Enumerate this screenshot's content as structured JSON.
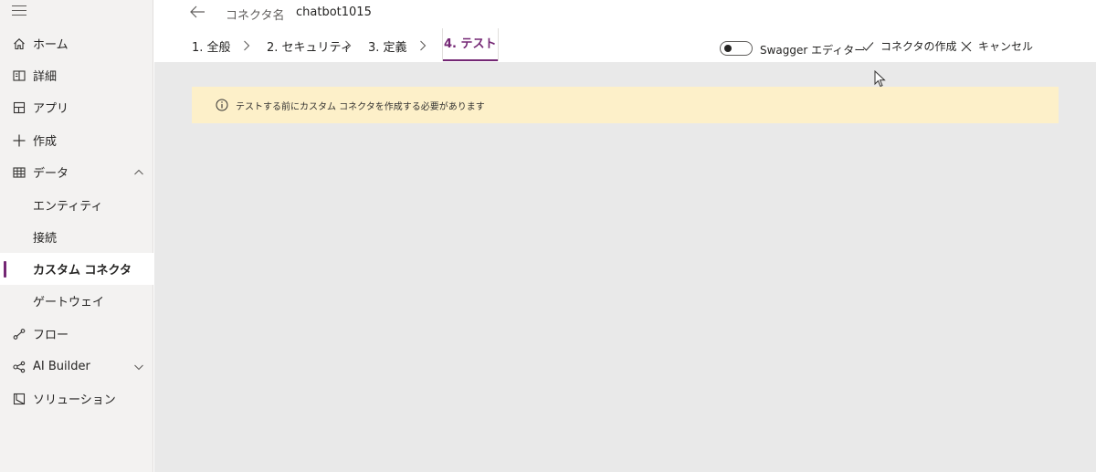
{
  "sidebar": {
    "items": [
      {
        "label": "ホーム",
        "icon": "home-icon"
      },
      {
        "label": "詳細",
        "icon": "book-icon"
      },
      {
        "label": "アプリ",
        "icon": "apps-icon"
      },
      {
        "label": "作成",
        "icon": "plus-icon"
      },
      {
        "label": "データ",
        "icon": "table-icon",
        "expanded": true
      },
      {
        "label": "エンティティ"
      },
      {
        "label": "接続"
      },
      {
        "label": "カスタム コネクタ",
        "selected": true
      },
      {
        "label": "ゲートウェイ"
      },
      {
        "label": "フロー",
        "icon": "flow-icon"
      },
      {
        "label": "AI Builder",
        "icon": "ai-builder-icon",
        "expanded": false
      },
      {
        "label": "ソリューション",
        "icon": "solution-icon"
      }
    ]
  },
  "header": {
    "connector_label": "コネクタ名",
    "connector_name": "chatbot1015"
  },
  "steps": [
    {
      "label": "1. 全般"
    },
    {
      "label": "2. セキュリティ"
    },
    {
      "label": "3. 定義"
    },
    {
      "label": "4. テスト",
      "active": true
    }
  ],
  "toolbar": {
    "swagger_label": "Swagger エディター",
    "swagger_on": false,
    "create_label": "コネクタの作成",
    "cancel_label": "キャンセル"
  },
  "banner": {
    "message": "テストする前にカスタム コネクタを作成する必要があります"
  },
  "colors": {
    "accent": "#742774",
    "banner_bg": "#fdf0c9",
    "content_bg": "#e9e9e9",
    "sidebar_bg": "#f3f2f1"
  }
}
